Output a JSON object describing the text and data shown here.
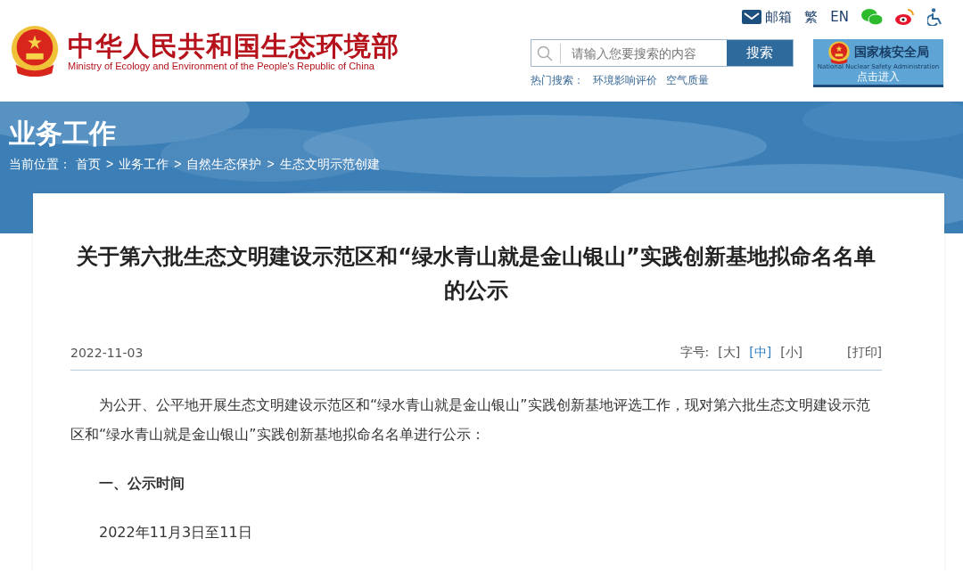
{
  "header": {
    "site_title": "中华人民共和国生态环境部",
    "site_subtitle": "Ministry of Ecology and Environment of the People's Republic of China",
    "top_links": [
      {
        "kind": "mail",
        "text": "邮箱"
      },
      {
        "kind": "text",
        "text": "繁"
      },
      {
        "kind": "text",
        "text": "EN"
      },
      {
        "kind": "wechat"
      },
      {
        "kind": "weibo"
      },
      {
        "kind": "accessibility"
      }
    ],
    "search": {
      "placeholder": "请输入您要搜索的内容",
      "button": "搜索"
    },
    "hot_search": {
      "label": "热门搜索：",
      "items": [
        "环境影响评价",
        "空气质量"
      ]
    },
    "partner": {
      "title": "国家核安全局",
      "subtitle": "National Nuclear Safety Administration",
      "action": "点击进入"
    }
  },
  "banner": {
    "title": "业务工作",
    "breadcrumb_label": "当前位置：",
    "breadcrumb": [
      {
        "kind": "link",
        "text": "首页"
      },
      {
        "kind": "sep",
        "text": ">"
      },
      {
        "kind": "link",
        "text": "业务工作"
      },
      {
        "kind": "sep",
        "text": ">"
      },
      {
        "kind": "link",
        "text": "自然生态保护"
      },
      {
        "kind": "sep",
        "text": ">"
      },
      {
        "kind": "link",
        "text": "生态文明示范创建"
      }
    ]
  },
  "article": {
    "title": "关于第六批生态文明建设示范区和“绿水青山就是金山银山”实践创新基地拟命名名单的公示",
    "date": "2022-11-03",
    "font_size_label": "字号:",
    "font_sizes": [
      {
        "text": "[大]",
        "selected": false
      },
      {
        "text": "[中]",
        "selected": true
      },
      {
        "text": "[小]",
        "selected": false
      }
    ],
    "print": "[打印]",
    "body": [
      {
        "kind": "paragraph",
        "text": "为公开、公平地开展生态文明建设示范区和“绿水青山就是金山银山”实践创新基地评选工作，现对第六批生态文明建设示范区和“绿水青山就是金山银山”实践创新基地拟命名名单进行公示："
      },
      {
        "kind": "heading",
        "text": "一、公示时间"
      },
      {
        "kind": "paragraph",
        "text": "2022年11月3日至11日"
      }
    ]
  }
}
